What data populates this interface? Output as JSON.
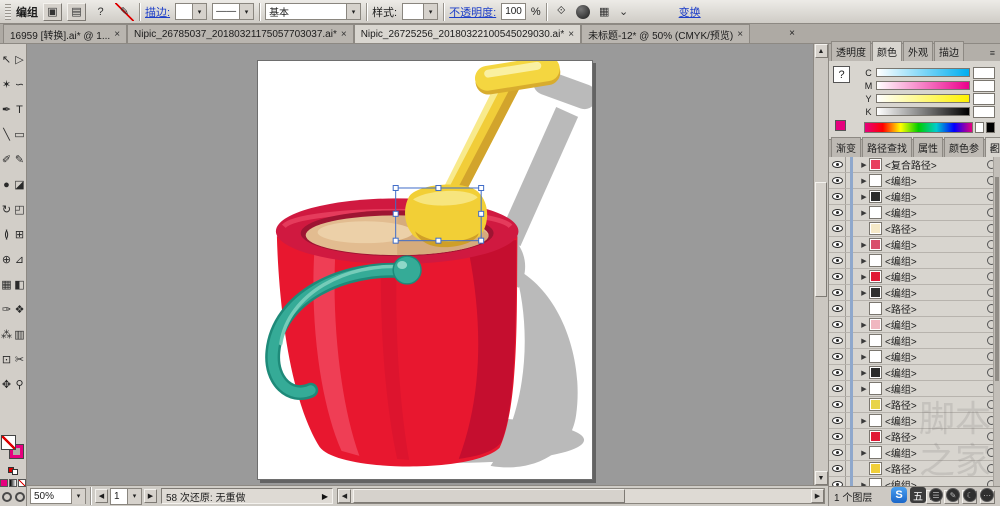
{
  "icon_glyphs": {
    "close": "×",
    "help": "?",
    "menu": "≡",
    "dropdown": "▾",
    "tri_right": "▶",
    "tri_left": "◀",
    "tri_up": "▲",
    "tri_down": "▼",
    "square_a": "▣",
    "square_b": "▤",
    "pen_slash": "✎",
    "reshape": "⟐",
    "align_grid": "▦",
    "spinner": "⌄",
    "profile_line": "—"
  },
  "control_bar": {
    "context_label": "编组",
    "stroke_link": "描边:",
    "profile_value": "——",
    "brush_value": "基本",
    "style_label": "样式:",
    "opacity_link": "不透明度:",
    "opacity_value": "100",
    "opacity_unit": "%",
    "transform_link": "变换"
  },
  "tabs": [
    {
      "label": "16959 [转换].ai* @ 1...",
      "active": false
    },
    {
      "label": "Nipic_26785037_20180321175057703037.ai*",
      "active": false
    },
    {
      "label": "Nipic_26725256_20180322100545029030.ai*",
      "active": true
    },
    {
      "label": "未标题-12* @ 50% (CMYK/预览)",
      "active": false
    }
  ],
  "tools": [
    {
      "name": "selection-tool",
      "glyph": "↖"
    },
    {
      "name": "direct-selection-tool",
      "glyph": "▷"
    },
    {
      "name": "magic-wand-tool",
      "glyph": "✶"
    },
    {
      "name": "lasso-tool",
      "glyph": "∽"
    },
    {
      "name": "pen-tool",
      "glyph": "✒"
    },
    {
      "name": "type-tool",
      "glyph": "T"
    },
    {
      "name": "line-segment-tool",
      "glyph": "╲"
    },
    {
      "name": "rectangle-tool",
      "glyph": "▭"
    },
    {
      "name": "paintbrush-tool",
      "glyph": "✐"
    },
    {
      "name": "pencil-tool",
      "glyph": "✎"
    },
    {
      "name": "blob-brush-tool",
      "glyph": "●"
    },
    {
      "name": "eraser-tool",
      "glyph": "◪"
    },
    {
      "name": "rotate-tool",
      "glyph": "↻"
    },
    {
      "name": "scale-tool",
      "glyph": "◰"
    },
    {
      "name": "width-tool",
      "glyph": "≬"
    },
    {
      "name": "free-transform-tool",
      "glyph": "⊞"
    },
    {
      "name": "shape-builder-tool",
      "glyph": "⊕"
    },
    {
      "name": "perspective-grid-tool",
      "glyph": "⊿"
    },
    {
      "name": "mesh-tool",
      "glyph": "▦"
    },
    {
      "name": "gradient-tool",
      "glyph": "◧"
    },
    {
      "name": "eyedropper-tool",
      "glyph": "✑"
    },
    {
      "name": "blend-tool",
      "glyph": "❖"
    },
    {
      "name": "symbol-sprayer-tool",
      "glyph": "⁂"
    },
    {
      "name": "column-graph-tool",
      "glyph": "▥"
    },
    {
      "name": "artboard-tool",
      "glyph": "⊡"
    },
    {
      "name": "slice-tool",
      "glyph": "✂"
    },
    {
      "name": "hand-tool",
      "glyph": "✥"
    },
    {
      "name": "zoom-tool",
      "glyph": "⚲"
    }
  ],
  "color_panel": {
    "tabs": [
      {
        "key": "transparency",
        "label": "透明度",
        "active": false
      },
      {
        "key": "color",
        "label": "颜色",
        "active": true
      },
      {
        "key": "appearance",
        "label": "外观",
        "active": false
      },
      {
        "key": "stroke",
        "label": "描边",
        "active": false
      }
    ],
    "proxy_glyph": "?",
    "fill_color": "#e6007e",
    "sliders": [
      {
        "label": "C"
      },
      {
        "label": "M"
      },
      {
        "label": "Y"
      },
      {
        "label": "K"
      }
    ]
  },
  "panel_tab_row2": [
    {
      "key": "gradient",
      "label": "渐变",
      "active": false
    },
    {
      "key": "pathfinder",
      "label": "路径查找",
      "active": false
    },
    {
      "key": "attributes",
      "label": "属性",
      "active": false
    },
    {
      "key": "color-guide",
      "label": "颜色参",
      "active": false
    },
    {
      "key": "layers",
      "label": "图层",
      "active": true
    }
  ],
  "layers": {
    "rows": [
      {
        "label": "<复合路径>",
        "thumb": "#e8405e",
        "expand": true
      },
      {
        "label": "<编组>",
        "thumb": "#ffffff",
        "expand": true
      },
      {
        "label": "<编组>",
        "thumb": "#2b2b2b",
        "expand": true
      },
      {
        "label": "<编组>",
        "thumb": "#ffffff",
        "expand": true
      },
      {
        "label": "<路径>",
        "thumb": "#f5e9c8",
        "expand": false
      },
      {
        "label": "<编组>",
        "thumb": "#d94f6b",
        "expand": true
      },
      {
        "label": "<编组>",
        "thumb": "#ffffff",
        "expand": true
      },
      {
        "label": "<编组>",
        "thumb": "#e01935",
        "expand": true
      },
      {
        "label": "<编组>",
        "thumb": "#303030",
        "expand": true
      },
      {
        "label": "<路径>",
        "thumb": "#ffffff",
        "expand": false
      },
      {
        "label": "<编组>",
        "thumb": "#f0b6c0",
        "expand": true
      },
      {
        "label": "<编组>",
        "thumb": "#ffffff",
        "expand": true
      },
      {
        "label": "<编组>",
        "thumb": "#ffffff",
        "expand": true
      },
      {
        "label": "<编组>",
        "thumb": "#2b2b2b",
        "expand": true
      },
      {
        "label": "<编组>",
        "thumb": "#ffffff",
        "expand": true
      },
      {
        "label": "<路径>",
        "thumb": "#e8d44a",
        "expand": false
      },
      {
        "label": "<编组>",
        "thumb": "#ffffff",
        "expand": true
      },
      {
        "label": "<路径>",
        "thumb": "#e01935",
        "expand": false
      },
      {
        "label": "<编组>",
        "thumb": "#ffffff",
        "expand": true
      },
      {
        "label": "<路径>",
        "thumb": "#f0cf3a",
        "expand": false
      },
      {
        "label": "<编组>",
        "thumb": "#ffffff",
        "expand": true
      }
    ],
    "footer_text": "1 个图层",
    "footer_icons": [
      {
        "name": "make-clipping-mask-button",
        "glyph": "◧"
      },
      {
        "name": "new-sublayer-button",
        "glyph": "⊞"
      },
      {
        "name": "new-layer-button",
        "glyph": "▣"
      },
      {
        "name": "delete-layer-button",
        "glyph": "✕"
      }
    ]
  },
  "status_bar": {
    "zoom_value": "50%",
    "artboard_value": "1",
    "status_text": "58 次还原: 无重做"
  },
  "ime": {
    "logo": "S",
    "mode": "五",
    "icons": [
      {
        "name": "ime-menu-icon",
        "glyph": "☰"
      },
      {
        "name": "ime-pen-icon",
        "glyph": "✎"
      },
      {
        "name": "ime-moon-icon",
        "glyph": "☾"
      },
      {
        "name": "ime-more-icon",
        "glyph": "⋯"
      }
    ]
  },
  "watermark": "脚本之家",
  "ui_colors": {
    "accent_selection": "#3f6cc8",
    "bucket_red": "#e8172f",
    "rim_red": "#d01940",
    "handle_teal": "#35ab97",
    "shovel_yellow": "#f2cf36",
    "sand_tan": "#e2bc90",
    "shadow_gray": "#bababa"
  }
}
